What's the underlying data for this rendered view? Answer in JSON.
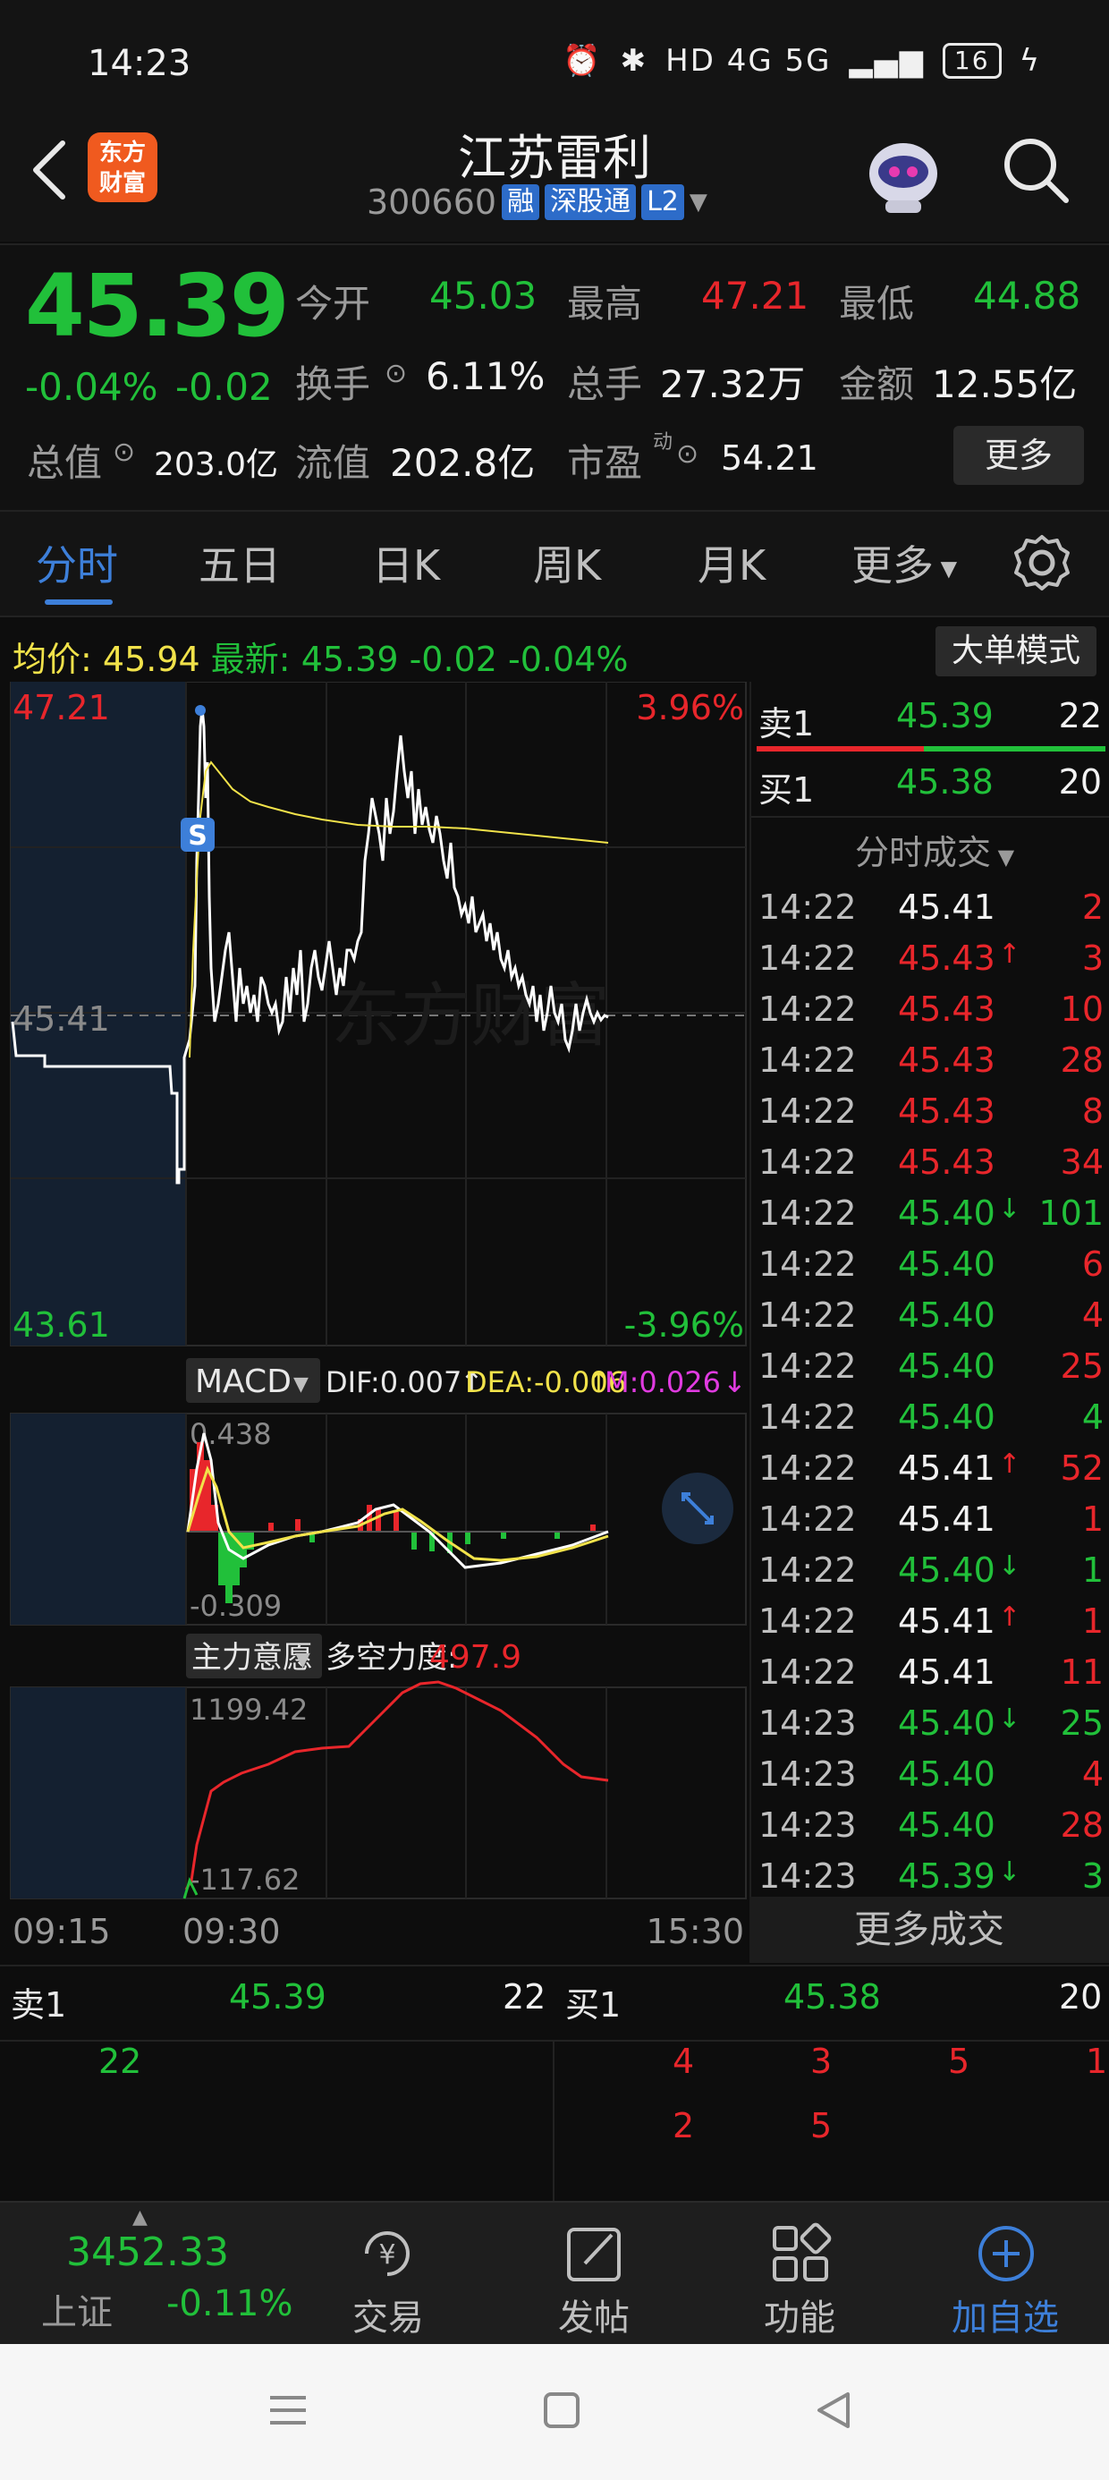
{
  "status_bar": {
    "time": "14:23",
    "network": "HD 4G 5G",
    "battery": "16"
  },
  "header": {
    "logo_text": "东方\n财富",
    "stock_name": "江苏雷利",
    "stock_code": "300660",
    "tags": [
      "融",
      "深股通",
      "L2"
    ]
  },
  "quote": {
    "price": "45.39",
    "change": "-0.04%",
    "change_abs": "-0.02",
    "open_label": "今开",
    "open": "45.03",
    "high_label": "最高",
    "high": "47.21",
    "low_label": "最低",
    "low": "44.88",
    "turnover_label": "换手",
    "turnover": "6.11%",
    "volume_label": "总手",
    "volume": "27.32万",
    "amount_label": "金额",
    "amount": "12.55亿",
    "mktcap_label": "总值",
    "mktcap": "203.0亿",
    "float_label": "流值",
    "float": "202.8亿",
    "pe_label": "市盈",
    "pe_sup": "动",
    "pe": "54.21",
    "more_label": "更多"
  },
  "tabs": [
    "分时",
    "五日",
    "日K",
    "周K",
    "月K",
    "更多"
  ],
  "avg_row": {
    "avg_label": "均价:",
    "avg": "45.94",
    "latest_label": "最新:",
    "latest": "45.39",
    "latest_chg": "-0.02",
    "latest_pct": "-0.04%",
    "big_order": "大单模式"
  },
  "chart": {
    "y_high": "47.21",
    "y_low": "43.61",
    "y_mid": "45.41",
    "pct_high": "3.96%",
    "pct_low": "-3.96%",
    "watermark": "东方财富",
    "s_marker": "S",
    "macd_label": "MACD",
    "dif": "DIF:0.007",
    "dea": "DEA:-0.006",
    "m": "M:0.026",
    "macd_high": "0.438",
    "macd_low": "-0.309",
    "ind2_label": "主力意愿",
    "ind2_name": "多空力度:",
    "ind2_val": "497.9",
    "ind2_high": "1199.42",
    "ind2_low": "-117.62",
    "time_start": "09:15",
    "time_open": "09:30",
    "time_end": "15:30",
    "colors": {
      "price": "#ffffff",
      "avg": "#f1e24a",
      "up": "#e8262b",
      "down": "#21c03a"
    }
  },
  "rpanel": {
    "sell1_label": "卖1",
    "sell1_price": "45.39",
    "sell1_vol": "22",
    "buy1_label": "买1",
    "buy1_price": "45.38",
    "buy1_vol": "20",
    "trades_title": "分时成交",
    "trades": [
      {
        "t": "14:22",
        "p": "45.41",
        "v": "2",
        "pc": "white",
        "vc": "red",
        "arrow": ""
      },
      {
        "t": "14:22",
        "p": "45.43",
        "v": "3",
        "pc": "red",
        "vc": "red",
        "arrow": "↑"
      },
      {
        "t": "14:22",
        "p": "45.43",
        "v": "10",
        "pc": "red",
        "vc": "red",
        "arrow": ""
      },
      {
        "t": "14:22",
        "p": "45.43",
        "v": "28",
        "pc": "red",
        "vc": "red",
        "arrow": ""
      },
      {
        "t": "14:22",
        "p": "45.43",
        "v": "8",
        "pc": "red",
        "vc": "red",
        "arrow": ""
      },
      {
        "t": "14:22",
        "p": "45.43",
        "v": "34",
        "pc": "red",
        "vc": "red",
        "arrow": ""
      },
      {
        "t": "14:22",
        "p": "45.40",
        "v": "101",
        "pc": "green",
        "vc": "green",
        "arrow": "↓"
      },
      {
        "t": "14:22",
        "p": "45.40",
        "v": "6",
        "pc": "green",
        "vc": "red",
        "arrow": ""
      },
      {
        "t": "14:22",
        "p": "45.40",
        "v": "4",
        "pc": "green",
        "vc": "red",
        "arrow": ""
      },
      {
        "t": "14:22",
        "p": "45.40",
        "v": "25",
        "pc": "green",
        "vc": "red",
        "arrow": ""
      },
      {
        "t": "14:22",
        "p": "45.40",
        "v": "4",
        "pc": "green",
        "vc": "green",
        "arrow": ""
      },
      {
        "t": "14:22",
        "p": "45.41",
        "v": "52",
        "pc": "white",
        "vc": "red",
        "arrow": "↑"
      },
      {
        "t": "14:22",
        "p": "45.41",
        "v": "1",
        "pc": "white",
        "vc": "red",
        "arrow": ""
      },
      {
        "t": "14:22",
        "p": "45.40",
        "v": "1",
        "pc": "green",
        "vc": "green",
        "arrow": "↓"
      },
      {
        "t": "14:22",
        "p": "45.41",
        "v": "1",
        "pc": "white",
        "vc": "red",
        "arrow": "↑"
      },
      {
        "t": "14:22",
        "p": "45.41",
        "v": "11",
        "pc": "white",
        "vc": "red",
        "arrow": ""
      },
      {
        "t": "14:23",
        "p": "45.40",
        "v": "25",
        "pc": "green",
        "vc": "green",
        "arrow": "↓"
      },
      {
        "t": "14:23",
        "p": "45.40",
        "v": "4",
        "pc": "green",
        "vc": "red",
        "arrow": ""
      },
      {
        "t": "14:23",
        "p": "45.40",
        "v": "28",
        "pc": "green",
        "vc": "red",
        "arrow": ""
      },
      {
        "t": "14:23",
        "p": "45.39",
        "v": "3",
        "pc": "green",
        "vc": "green",
        "arrow": "↓"
      }
    ],
    "more_trades": "更多成交"
  },
  "book": {
    "sell_label": "卖1",
    "sell_price": "45.39",
    "sell_vol": "22",
    "buy_label": "买1",
    "buy_price": "45.38",
    "buy_vol": "20",
    "sell_orders": [
      "22"
    ],
    "buy_orders_row1": [
      "4",
      "3",
      "5",
      "1"
    ],
    "buy_orders_row2": [
      "2",
      "5"
    ]
  },
  "nav": {
    "index_value": "3452.33",
    "index_name": "上证",
    "index_chg": "-0.11%",
    "items": [
      "交易",
      "发帖",
      "功能",
      "加自选"
    ]
  }
}
